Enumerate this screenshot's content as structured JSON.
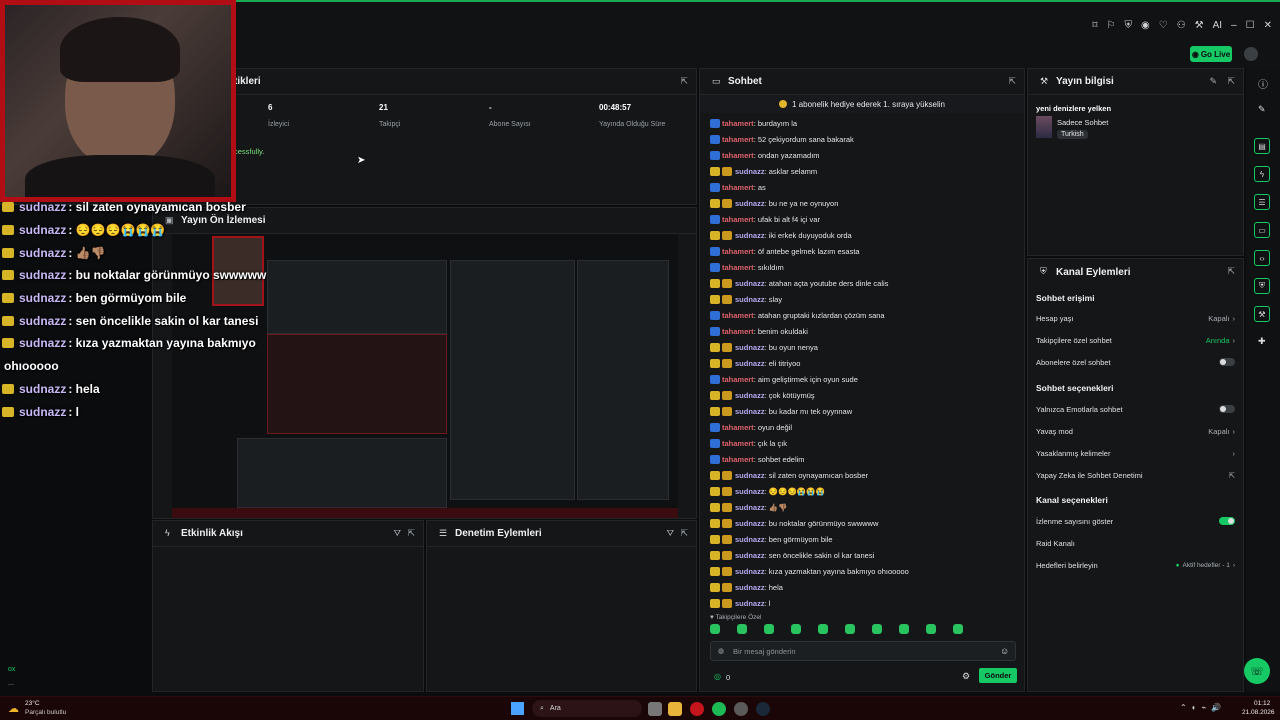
{
  "stream_stats": {
    "title_fragment": "tikleri",
    "items": [
      {
        "value": "6",
        "label": "İzleyici"
      },
      {
        "value": "21",
        "label": "Takipçi"
      },
      {
        "value": "-",
        "label": "Abone Sayısı"
      },
      {
        "value": "00:48:57",
        "label": "Yayında Olduğu Süre"
      }
    ],
    "status_fragment": "cessfully."
  },
  "preview": {
    "title": "Yayın Ön İzlemesi"
  },
  "activity": {
    "title": "Etkinlik Akışı"
  },
  "moderation": {
    "title": "Denetim Eylemleri"
  },
  "top": {
    "go_live": "Go Live",
    "ai_label": "AI"
  },
  "overlay_chat": [
    {
      "user": "sudnazz",
      "text": " : sil zaten oynayamıcan bosber"
    },
    {
      "user": "sudnazz",
      "text": " : 😔😔😔😭😭😭"
    },
    {
      "user": "sudnazz",
      "text": " : 👍🏽👎🏽"
    },
    {
      "user": "sudnazz",
      "text": " : bu noktalar görünmüyo swwwww"
    },
    {
      "user": "sudnazz",
      "text": " : ben görmüyom bile"
    },
    {
      "user": "sudnazz",
      "text": " : sen öncelikle sakin ol kar tanesi"
    },
    {
      "user": "sudnazz",
      "text": " : kıza yazmaktan yayına bakmıyo"
    },
    {
      "user": "",
      "text": "ohıooooo"
    },
    {
      "user": "sudnazz",
      "text": " : hela"
    },
    {
      "user": "sudnazz",
      "text": " : l"
    }
  ],
  "chat": {
    "title": "Sohbet",
    "banner": "1 abonelik hediye ederek 1. sıraya yükselin",
    "messages": [
      {
        "user": "tahamert",
        "type": "t",
        "text": ": burdayım la"
      },
      {
        "user": "tahamert",
        "type": "t",
        "text": ": 52 çekiyordum sana bakarak"
      },
      {
        "user": "tahamert",
        "type": "t",
        "text": ": ondan yazamadım"
      },
      {
        "user": "sudnazz",
        "type": "s",
        "text": ": asklar selamm"
      },
      {
        "user": "tahamert",
        "type": "t",
        "text": ": as"
      },
      {
        "user": "sudnazz",
        "type": "s",
        "text": ": bu ne ya ne oynuyon"
      },
      {
        "user": "tahamert",
        "type": "t",
        "text": ": ufak bi alt f4 içi var"
      },
      {
        "user": "sudnazz",
        "type": "s",
        "text": ": iki erkek duyuyoduk orda"
      },
      {
        "user": "tahamert",
        "type": "t",
        "text": ": öf antebe gelmek lazım esasta"
      },
      {
        "user": "tahamert",
        "type": "t",
        "text": ": sıkıldım"
      },
      {
        "user": "sudnazz",
        "type": "s",
        "text": ": atahan açta youtube ders dinle calis"
      },
      {
        "user": "sudnazz",
        "type": "s",
        "text": ": slay"
      },
      {
        "user": "tahamert",
        "type": "t",
        "text": ": atahan gruptaki kızlardan çözüm sana"
      },
      {
        "user": "tahamert",
        "type": "t",
        "text": ": benim okuldaki"
      },
      {
        "user": "sudnazz",
        "type": "s",
        "text": ": bu oyun nenya"
      },
      {
        "user": "sudnazz",
        "type": "s",
        "text": ": eli titriyoo"
      },
      {
        "user": "tahamert",
        "type": "t",
        "text": ": aim geliştirmek için oyun sude"
      },
      {
        "user": "sudnazz",
        "type": "s",
        "text": ": çok kötüymüş"
      },
      {
        "user": "sudnazz",
        "type": "s",
        "text": ": bu kadar mı tek oyynnaw"
      },
      {
        "user": "tahamert",
        "type": "t",
        "text": ": oyun değil"
      },
      {
        "user": "tahamert",
        "type": "t",
        "text": ": çık la çık"
      },
      {
        "user": "tahamert",
        "type": "t",
        "text": ": sohbet edelim"
      },
      {
        "user": "sudnazz",
        "type": "s",
        "text": ": sil zaten oynayamıcan bosber"
      },
      {
        "user": "sudnazz",
        "type": "s",
        "text": ": 😔😔😔😭😭😭"
      },
      {
        "user": "sudnazz",
        "type": "s",
        "text": ": 👍🏽👎🏽"
      },
      {
        "user": "sudnazz",
        "type": "s",
        "text": ": bu noktalar görünmüyo swwwww"
      },
      {
        "user": "sudnazz",
        "type": "s",
        "text": ": ben görmüyom bile"
      },
      {
        "user": "sudnazz",
        "type": "s",
        "text": ": sen öncelikle sakin ol kar tanesi"
      },
      {
        "user": "sudnazz",
        "type": "s",
        "text": ": kıza yazmaktan yayına bakmıyo ohıooooo"
      },
      {
        "user": "sudnazz",
        "type": "s",
        "text": ": hela"
      },
      {
        "user": "sudnazz",
        "type": "s",
        "text": ": l"
      }
    ],
    "followers_only": "Takipçilere Özel",
    "input_placeholder": "Bir mesaj gönderin",
    "points": "0",
    "send": "Gönder"
  },
  "stream_info": {
    "title": "Yayın bilgisi",
    "stream_title": "yeni denizlere yelken",
    "category": "Sadece Sohbet",
    "tag": "Turkish"
  },
  "channel_actions": {
    "title": "Kanal Eylemleri",
    "chat_access": "Sohbet erişimi",
    "age": {
      "label": "Hesap yaşı",
      "value": "Kapalı"
    },
    "followers_chat": {
      "label": "Takipçilere özel sohbet",
      "value": "Anında"
    },
    "subs_chat": {
      "label": "Abonelere özel sohbet"
    },
    "chat_options": "Sohbet seçenekleri",
    "emotes_only": {
      "label": "Yalnızca Emotlarla sohbet"
    },
    "slow_mode": {
      "label": "Yavaş mod",
      "value": "Kapalı"
    },
    "banned_words": {
      "label": "Yasaklanmış kelimeler"
    },
    "ai_moderation": {
      "label": "Yapay Zeka ile Sohbet Denetimi"
    },
    "channel_options": "Kanal seçenekleri",
    "viewer_count": {
      "label": "İzlenme sayısını göster"
    },
    "raid": {
      "label": "Raid Kanalı"
    },
    "goals": {
      "label": "Hedefleri belirleyin",
      "value": "Aktif hedefler - 1"
    }
  },
  "taskbar": {
    "weather_temp": "23°C",
    "weather_desc": "Parçalı bulutlu",
    "search": "Ara",
    "time": "01:12",
    "date": "21.08.2026"
  },
  "left_bottom": {
    "a": "ox",
    "b": "..."
  },
  "colors": {
    "accent": "#17c964",
    "tahamert": "#e0626b",
    "sudnazz": "#b7a8f0",
    "webcam_frame": "#b00d14"
  }
}
